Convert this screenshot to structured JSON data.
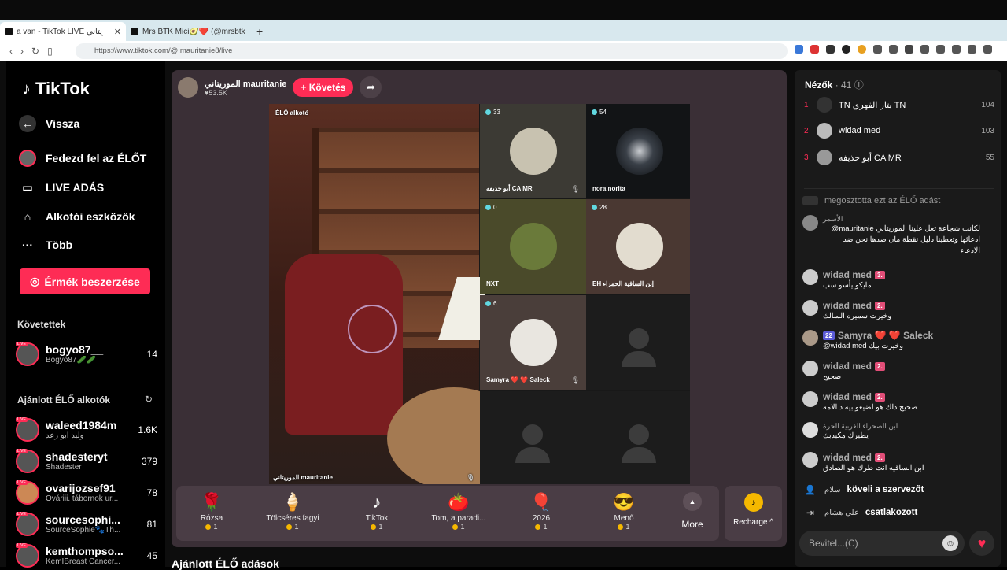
{
  "browser": {
    "tab1_title": "a van - TikTok LIVE الموريتاني",
    "tab2_title": "Mrs BTK Mici🥑❤️ (@mrsbtk) F",
    "url": "https://www.tiktok.com/@.mauritanie8/live",
    "close": "✕",
    "newtab": "+"
  },
  "nav": {
    "logo": "TikTok",
    "back": "Vissza",
    "items": [
      "Fedezd fel az ÉLŐT",
      "LIVE ADÁS",
      "Alkotói eszközök",
      "Több"
    ],
    "coins": "Érmék beszerzése",
    "followed_heading": "Követettek",
    "followed": [
      {
        "name": "bogyo87__",
        "sub": "Bogyó87🥒🥒",
        "count": "14"
      }
    ],
    "recommended_heading": "Ajánlott ÉLŐ alkotók",
    "recommended": [
      {
        "name": "waleed1984m",
        "sub": "وليد ابو رعد",
        "count": "1.6K"
      },
      {
        "name": "shadesteryt",
        "sub": "Shadester",
        "count": "379"
      },
      {
        "name": "ovarijozsef91",
        "sub": "Ováriii. tábornok ur...",
        "count": "78"
      },
      {
        "name": "sourcesophi...",
        "sub": "SourceSophie🐾Th...",
        "count": "81"
      },
      {
        "name": "kemthompso...",
        "sub": "KemIBreast Cancer...",
        "count": "45"
      }
    ],
    "live_badge": "LIVE"
  },
  "stage": {
    "host": "الموريتاني mauritanie",
    "likes": "♥53.5K",
    "follow": "+ Követés",
    "feed_label": "ÉLŐ alkotó",
    "main_name": "الموريتاني mauritanie",
    "guests": [
      {
        "count": "33",
        "name": "أبو حذيفه CA MR"
      },
      {
        "count": "54",
        "name": "nora norita"
      },
      {
        "count": "0",
        "name": "NXT"
      },
      {
        "count": "28",
        "name": "EH إبن الساقية الحمراء"
      },
      {
        "count": "6",
        "name": "Samyra ❤️ ❤️ Saleck"
      }
    ],
    "gifts": [
      {
        "icon": "🌹",
        "name": "Rózsa",
        "cost": "1"
      },
      {
        "icon": "🍦",
        "name": "Tölcséres fagyi",
        "cost": "1"
      },
      {
        "icon": "♪",
        "name": "TikTok",
        "cost": "1"
      },
      {
        "icon": "🍅",
        "name": "Tom, a paradi...",
        "cost": "1"
      },
      {
        "icon": "🎈",
        "name": "2026",
        "cost": "1"
      },
      {
        "icon": "😎",
        "name": "Menő",
        "cost": "1"
      }
    ],
    "more": "More",
    "recharge": "Recharge ^",
    "recommended_heading": "Ajánlott ÉLŐ adások"
  },
  "panel": {
    "title": "Nézők",
    "count": "· 41",
    "viewers": [
      {
        "rank": "1",
        "name": "TN بتار الفهري TN",
        "score": "104"
      },
      {
        "rank": "2",
        "name": "widad med",
        "score": "103"
      },
      {
        "rank": "3",
        "name": "أبو حذيفه CA MR",
        "score": "55"
      }
    ],
    "shared": "megosztotta ezt az ÉLŐ adást",
    "messages": [
      {
        "user": "الأسمر",
        "lvl": "",
        "text": "لكانت شجاعة تعل علينا الموريتاني mauritanie@ ادعائها وتعطينا دليل نقطة مان صدها نحن ضد الادعاء"
      },
      {
        "user": "widad med",
        "lvl": "3.",
        "text": "مايكو يأسو سب"
      },
      {
        "user": "widad med",
        "lvl": "2.",
        "text": "وخيرت سميره السالك"
      },
      {
        "user": "Samyra ❤️ ❤️ Saleck",
        "lvl": "22",
        "text": "@widad med وخيرت بيك"
      },
      {
        "user": "widad med",
        "lvl": "2.",
        "text": "صحيح"
      },
      {
        "user": "widad med",
        "lvl": "2.",
        "text": "صحيح ذاك هو لضيعو بيه د الامه"
      },
      {
        "user": "ابن الصحراء الغربية الحرة",
        "lvl": "",
        "text": "يطيرك مكيدبك"
      },
      {
        "user": "widad med",
        "lvl": "2.",
        "text": "ابن الساقيه انت طرك هو الصادق"
      }
    ],
    "follow_host": "köveli a szervezőt",
    "follow_host_user": "سلام",
    "joined_user": "علي هشام",
    "joined": "csatlakozott",
    "input_placeholder": "Bevitel...(C)",
    "heart": "♥"
  },
  "colors": {
    "accent": "#fe2c55",
    "stage_bg": "#3a2f36",
    "panel_bg": "#1a1a1a",
    "coin": "#f5b800"
  }
}
